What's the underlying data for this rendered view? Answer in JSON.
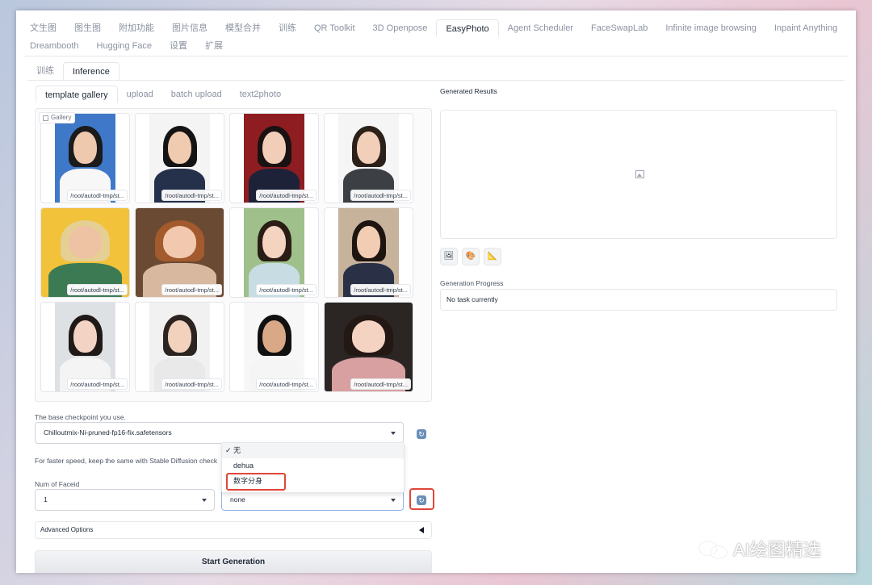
{
  "main_tabs": [
    {
      "label": "文生图"
    },
    {
      "label": "图生图"
    },
    {
      "label": "附加功能"
    },
    {
      "label": "图片信息"
    },
    {
      "label": "模型合并"
    },
    {
      "label": "训练"
    },
    {
      "label": "QR Toolkit"
    },
    {
      "label": "3D Openpose"
    },
    {
      "label": "EasyPhoto",
      "active": true
    },
    {
      "label": "Agent Scheduler"
    },
    {
      "label": "FaceSwapLab"
    },
    {
      "label": "Infinite image browsing"
    },
    {
      "label": "Inpaint Anything"
    },
    {
      "label": "Dreambooth"
    },
    {
      "label": "Hugging Face"
    },
    {
      "label": "设置"
    },
    {
      "label": "扩展"
    }
  ],
  "sub_tabs": [
    {
      "label": "训练"
    },
    {
      "label": "Inference",
      "active": true
    }
  ],
  "source_tabs": [
    {
      "label": "template gallery",
      "active": true
    },
    {
      "label": "upload"
    },
    {
      "label": "batch upload"
    },
    {
      "label": "text2photo"
    }
  ],
  "gallery": {
    "label": "Gallery",
    "items": [
      {
        "caption": "/root/autodl-tmp/st...",
        "bg": "#3f78c8",
        "skin": "#efc9ae",
        "hair": "#1b1b1b",
        "cloth": "#f7f7f7"
      },
      {
        "caption": "/root/autodl-tmp/st...",
        "bg": "#f4f4f4",
        "skin": "#f0cbb0",
        "hair": "#141414",
        "cloth": "#25304a"
      },
      {
        "caption": "/root/autodl-tmp/st...",
        "bg": "#8e1d22",
        "skin": "#f2cdb8",
        "hair": "#1a1212",
        "cloth": "#1d2238"
      },
      {
        "caption": "/root/autodl-tmp/st...",
        "bg": "#f5f5f5",
        "skin": "#f2cfb8",
        "hair": "#2b201a",
        "cloth": "#3c3f44"
      },
      {
        "caption": "/root/autodl-tmp/st...",
        "bg": "#f1c23a",
        "skin": "#eec3a3",
        "hair": "#e6cf93",
        "cloth": "#3c7a54"
      },
      {
        "caption": "/root/autodl-tmp/st...",
        "bg": "#6b4a33",
        "skin": "#f2c9ae",
        "hair": "#a35a2d",
        "cloth": "#d9b8a0"
      },
      {
        "caption": "/root/autodl-tmp/st...",
        "bg": "#9fc08a",
        "skin": "#f4d3c0",
        "hair": "#2a1d16",
        "cloth": "#c7dde3"
      },
      {
        "caption": "/root/autodl-tmp/st...",
        "bg": "#c7b29c",
        "skin": "#f2cdb3",
        "hair": "#1d1410",
        "cloth": "#2a3146"
      },
      {
        "caption": "/root/autodl-tmp/st...",
        "bg": "#dde1e3",
        "skin": "#f3d3c3",
        "hair": "#1f1a17",
        "cloth": "#f4f4f4"
      },
      {
        "caption": "/root/autodl-tmp/st...",
        "bg": "#f1f1f1",
        "skin": "#f2d1bd",
        "hair": "#2b2420",
        "cloth": "#e9e9e9"
      },
      {
        "caption": "/root/autodl-tmp/st...",
        "bg": "#f7f7f7",
        "skin": "#d9a887",
        "hair": "#111111",
        "cloth": "#f5f5f5"
      },
      {
        "caption": "/root/autodl-tmp/st...",
        "bg": "#2b2524",
        "skin": "#f5d3c2",
        "hair": "#241814",
        "cloth": "#d8a0a0"
      }
    ]
  },
  "checkpoint": {
    "label": "The base checkpoint you use.",
    "value": "Chilloutmix-Ni-pruned-fp16-fix.safetensors"
  },
  "speed_note": "For faster speed, keep the same with Stable Diffusion check",
  "faceid": {
    "label": "Num of Faceid",
    "value": "1"
  },
  "user_id": {
    "value": "none"
  },
  "dropdown": {
    "items": [
      "✓ 无",
      "dehua",
      "数字分身"
    ]
  },
  "advanced_label": "Advanced Options",
  "start_label": "Start Generation",
  "results": {
    "title": "Generated Results",
    "progress_label": "Generation Progress",
    "progress_value": "No task currently"
  },
  "watermark": "AI绘图精选",
  "colors": {
    "highlight_red": "#e0463a",
    "refresh_blue": "#6b8fb8"
  }
}
